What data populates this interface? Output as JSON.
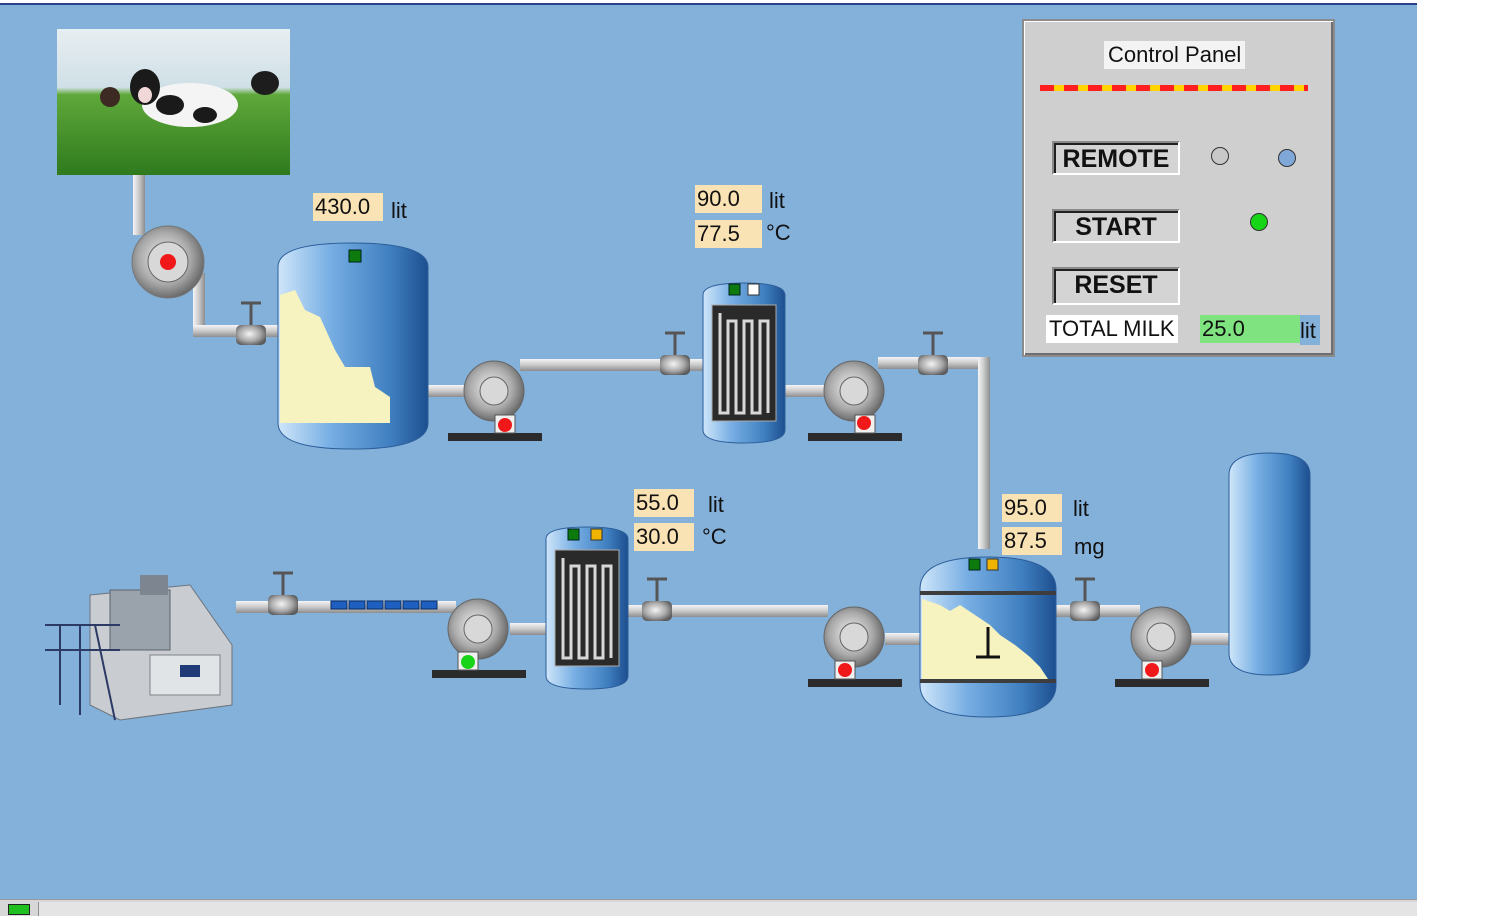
{
  "tanks": {
    "raw_tank": {
      "volume_value": "430.0",
      "volume_unit": "lit"
    },
    "pasteurizer": {
      "volume_value": "90.0",
      "volume_unit": "lit",
      "temp_value": "77.5",
      "temp_unit": "°C"
    },
    "cooler": {
      "volume_value": "55.0",
      "volume_unit": "lit",
      "temp_value": "30.0",
      "temp_unit": "°C"
    },
    "mix_tank": {
      "volume_value": "95.0",
      "volume_unit": "lit",
      "mass_value": "87.5",
      "mass_unit": "mg"
    }
  },
  "control_panel": {
    "title": "Control Panel",
    "remote_label": "REMOTE",
    "start_label": "START",
    "reset_label": "RESET",
    "total_label": "TOTAL MILK",
    "total_value": "25.0",
    "total_unit": "lit"
  },
  "indicators": {
    "remote_lamp_local": "#c8c8c8",
    "remote_lamp_remote": "#7fa8d8",
    "start_lamp": "#16d416"
  },
  "colors": {
    "background": "#84b1da",
    "milk": "#f7f3c1",
    "pump_running": "#18d418",
    "pump_stopped": "#f01818",
    "status_green": "#0c7a0c",
    "status_amber": "#f0b400"
  }
}
